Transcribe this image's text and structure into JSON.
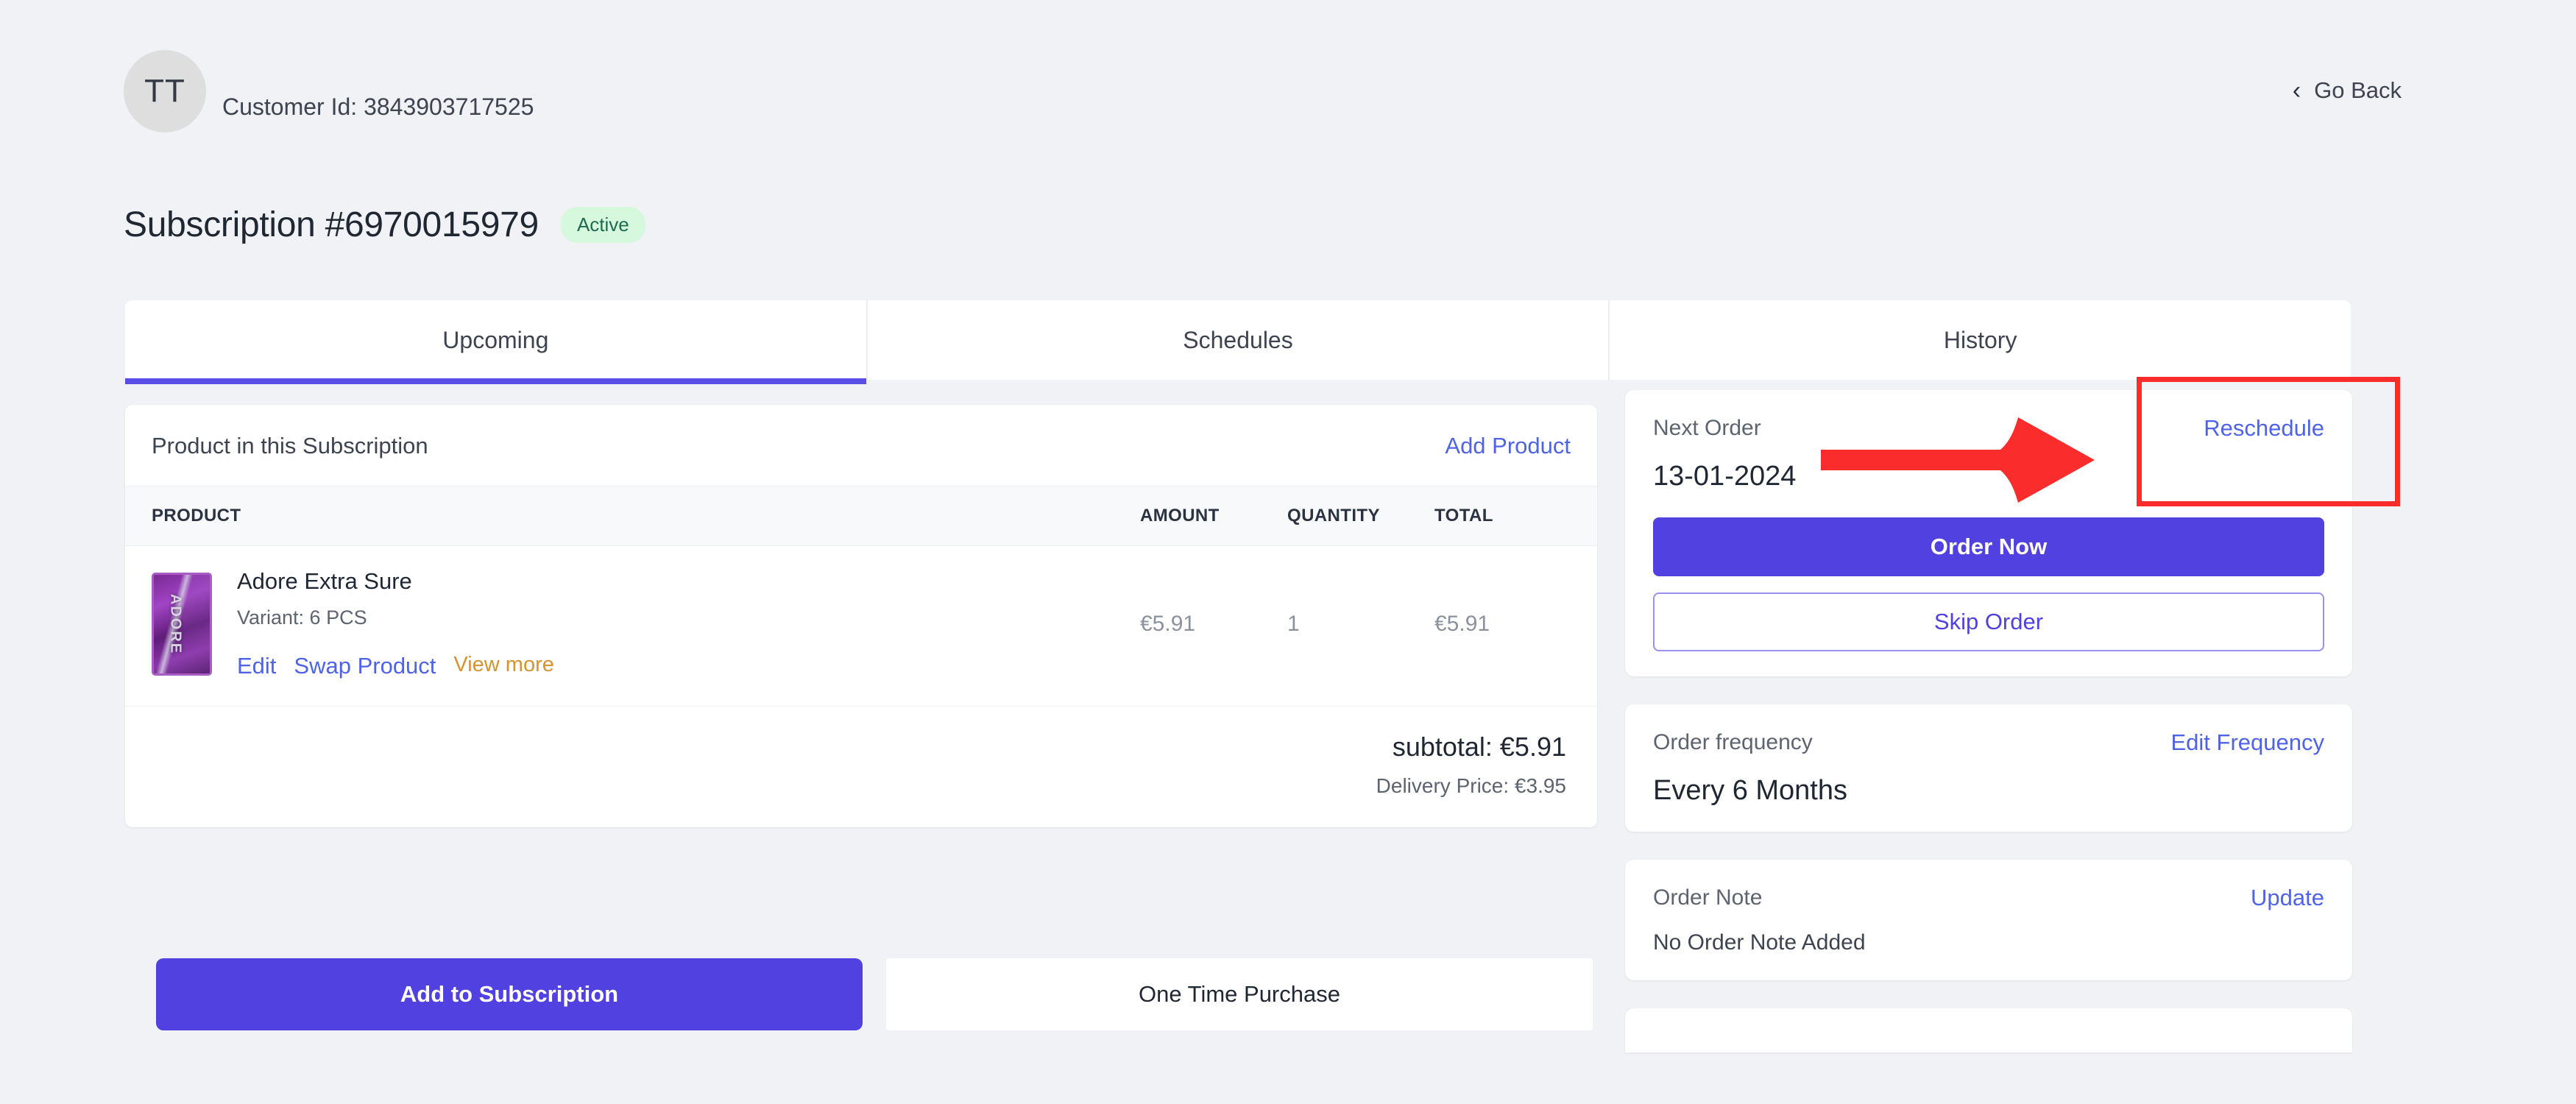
{
  "header": {
    "avatar_initials": "TT",
    "customer_id_label": "Customer Id: 3843903717525",
    "go_back_label": "Go Back",
    "chevron_glyph": "‹"
  },
  "title": {
    "text": "Subscription #6970015979",
    "status_badge": "Active"
  },
  "tabs": [
    {
      "label": "Upcoming",
      "active": true
    },
    {
      "label": "Schedules",
      "active": false
    },
    {
      "label": "History",
      "active": false
    }
  ],
  "products_card": {
    "heading": "Product in this Subscription",
    "add_product_label": "Add Product",
    "columns": [
      "PRODUCT",
      "AMOUNT",
      "QUANTITY",
      "TOTAL"
    ],
    "rows": [
      {
        "name": "Adore Extra Sure",
        "variant": "Variant: 6 PCS",
        "amount": "€5.91",
        "quantity": "1",
        "total": "€5.91",
        "actions": [
          "Edit",
          "Swap Product",
          "View more"
        ],
        "thumb_text": "ADORE"
      }
    ],
    "subtotal": "subtotal: €5.91",
    "delivery": "Delivery Price: €3.95"
  },
  "bottom_actions": {
    "add_to_subscription": "Add to Subscription",
    "one_time_purchase": "One Time Purchase"
  },
  "next_order": {
    "label": "Next Order",
    "reschedule_label": "Reschedule",
    "date": "13-01-2024",
    "order_now_label": "Order Now",
    "skip_order_label": "Skip Order"
  },
  "order_frequency": {
    "label": "Order frequency",
    "edit_label": "Edit Frequency",
    "value": "Every 6 Months"
  },
  "order_note": {
    "label": "Order Note",
    "update_label": "Update",
    "value": "No Order Note Added"
  },
  "colors": {
    "accent_purple": "#5041e0",
    "link_blue": "#4f63e8",
    "link_amber": "#d59430",
    "badge_bg": "#d6f8dd",
    "badge_text": "#1f6b52",
    "annotation_red": "#fb2c2c",
    "page_bg": "#f1f2f5"
  }
}
